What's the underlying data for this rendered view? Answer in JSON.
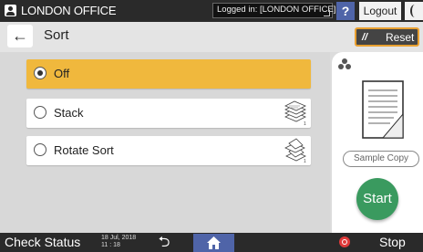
{
  "topbar": {
    "office": "LONDON OFFICE",
    "login_status": "Logged in: [LONDON OFFICE]",
    "help_label": "?",
    "logout_label": "Logout"
  },
  "header": {
    "back_label": "←",
    "title": "Sort",
    "reset_label": "Reset"
  },
  "options": [
    {
      "label": "Off",
      "selected": true
    },
    {
      "label": "Stack",
      "selected": false
    },
    {
      "label": "Rotate Sort",
      "selected": false
    }
  ],
  "right_panel": {
    "sample_copy_label": "Sample Copy",
    "start_label": "Start",
    "start_color": "#3a9a5f"
  },
  "bottombar": {
    "check_status_label": "Check Status",
    "date": "18 Jul, 2018",
    "time": "11 : 18",
    "stop_label": "Stop"
  },
  "colors": {
    "selected_option": "#f0b83d",
    "reset_border": "#e9a030",
    "accent_blue": "#4f64a8"
  }
}
